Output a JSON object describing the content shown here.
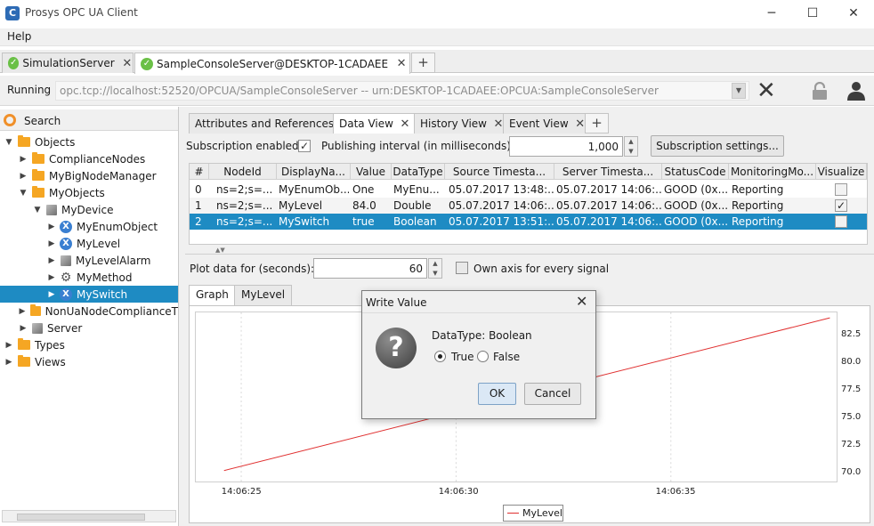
{
  "window": {
    "title": "Prosys OPC UA Client",
    "minimize": "─",
    "maximize": "☐",
    "close": "✕"
  },
  "menu": {
    "help": "Help"
  },
  "server_tabs": {
    "tab1": "SimulationServer",
    "tab2": "SampleConsoleServer@DESKTOP-1CADAEE",
    "close": "✕",
    "add": "+"
  },
  "connection": {
    "status": "Running",
    "address": "opc.tcp://localhost:52520/OPCUA/SampleConsoleServer -- urn:DESKTOP-1CADAEE:OPCUA:SampleConsoleServer",
    "disconnect_glyph": "✕"
  },
  "sidebar": {
    "search_label": "Search",
    "tree": [
      {
        "label": "Objects"
      },
      {
        "label": "ComplianceNodes"
      },
      {
        "label": "MyBigNodeManager"
      },
      {
        "label": "MyObjects"
      },
      {
        "label": "MyDevice"
      },
      {
        "label": "MyEnumObject"
      },
      {
        "label": "MyLevel"
      },
      {
        "label": "MyLevelAlarm"
      },
      {
        "label": "MyMethod"
      },
      {
        "label": "MySwitch"
      },
      {
        "label": "NonUaNodeComplianceT"
      },
      {
        "label": "Server"
      },
      {
        "label": "Types"
      },
      {
        "label": "Views"
      }
    ]
  },
  "view_tabs": {
    "attributes": "Attributes and References",
    "data": "Data View",
    "history": "History View",
    "event": "Event View",
    "close": "✕",
    "add": "+"
  },
  "subscription": {
    "enabled_label": "Subscription enabled",
    "enabled_checked": "✓",
    "interval_label": "Publishing interval (in milliseconds):",
    "interval_value": "1,000",
    "settings_button": "Subscription settings..."
  },
  "table": {
    "columns": [
      "#",
      "NodeId",
      "DisplayNa...",
      "Value",
      "DataType",
      "Source Timesta...",
      "Server Timesta...",
      "StatusCode",
      "MonitoringMo...",
      "Visualize"
    ],
    "rows": [
      {
        "n": "0",
        "nodeid": "ns=2;s=...",
        "name": "MyEnumOb...",
        "value": "One",
        "type": "MyEnu...",
        "source": "05.07.2017 13:48:...",
        "server": "05.07.2017 14:06:...",
        "status": "GOOD (0x...",
        "mode": "Reporting",
        "visualize": ""
      },
      {
        "n": "1",
        "nodeid": "ns=2;s=...",
        "name": "MyLevel",
        "value": "84.0",
        "type": "Double",
        "source": "05.07.2017 14:06:...",
        "server": "05.07.2017 14:06:...",
        "status": "GOOD (0x...",
        "mode": "Reporting",
        "visualize": "✓"
      },
      {
        "n": "2",
        "nodeid": "ns=2;s=...",
        "name": "MySwitch",
        "value": "true",
        "type": "Boolean",
        "source": "05.07.2017 13:51:...",
        "server": "05.07.2017 14:06:...",
        "status": "GOOD (0x...",
        "mode": "Reporting",
        "visualize": ""
      }
    ]
  },
  "plot_controls": {
    "label": "Plot data for (seconds):",
    "value": "60",
    "own_axis_label": "Own axis for every signal"
  },
  "graph_tabs": {
    "graph": "Graph",
    "mylevel": "MyLevel"
  },
  "chart_data": {
    "type": "line",
    "title": "",
    "xlabel": "",
    "ylabel": "",
    "x_ticks": [
      "14:06:25",
      "14:06:30",
      "14:06:35"
    ],
    "y_ticks": [
      "82.5",
      "80.0",
      "77.5",
      "75.0",
      "72.5",
      "70.0"
    ],
    "ylim": [
      69.0,
      84.5
    ],
    "series": [
      {
        "name": "MyLevel",
        "color": "#e03030",
        "x_seconds": [
          24.6,
          38.7
        ],
        "values": [
          70.0,
          84.0
        ]
      }
    ],
    "x_range_seconds": [
      24.0,
      38.8
    ],
    "grid": true,
    "legend": "bottom-center"
  },
  "dialog": {
    "title": "Write Value",
    "close": "✕",
    "question_glyph": "?",
    "datatype": "DataType: Boolean",
    "true_label": "True",
    "false_label": "False",
    "ok": "OK",
    "cancel": "Cancel"
  }
}
